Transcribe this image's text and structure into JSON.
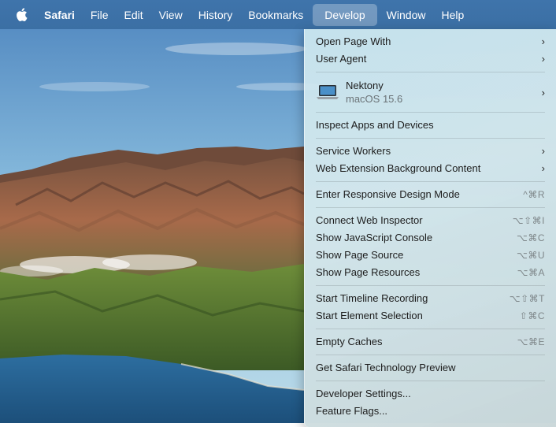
{
  "menubar": {
    "apple_icon": "apple-logo-icon",
    "items": [
      {
        "label": "Safari",
        "bold": true
      },
      {
        "label": "File"
      },
      {
        "label": "Edit"
      },
      {
        "label": "View"
      },
      {
        "label": "History"
      },
      {
        "label": "Bookmarks"
      },
      {
        "label": "Develop",
        "active": true
      },
      {
        "label": "Window"
      },
      {
        "label": "Help"
      }
    ]
  },
  "develop_menu": {
    "open_page_with": "Open Page With",
    "user_agent": "User Agent",
    "device": {
      "name": "Nektony",
      "os": "macOS 15.6",
      "icon": "laptop-icon"
    },
    "inspect_apps": "Inspect Apps and Devices",
    "service_workers": "Service Workers",
    "web_extension_bg": "Web Extension Background Content",
    "responsive_design": {
      "label": "Enter Responsive Design Mode",
      "shortcut": "^⌘R"
    },
    "connect_inspector": {
      "label": "Connect Web Inspector",
      "shortcut": "⌥⇧⌘I"
    },
    "js_console": {
      "label": "Show JavaScript Console",
      "shortcut": "⌥⌘C"
    },
    "page_source": {
      "label": "Show Page Source",
      "shortcut": "⌥⌘U"
    },
    "page_resources": {
      "label": "Show Page Resources",
      "shortcut": "⌥⌘A"
    },
    "timeline": {
      "label": "Start Timeline Recording",
      "shortcut": "⌥⇧⌘T"
    },
    "element_selection": {
      "label": "Start Element Selection",
      "shortcut": "⇧⌘C"
    },
    "empty_caches": {
      "label": "Empty Caches",
      "shortcut": "⌥⌘E"
    },
    "tech_preview": "Get Safari Technology Preview",
    "dev_settings": "Developer Settings...",
    "feature_flags": "Feature Flags..."
  },
  "colors": {
    "menubar": "#3d72a8",
    "highlight": "#5a8cc0",
    "menu_bg": "#d3e7ee"
  }
}
